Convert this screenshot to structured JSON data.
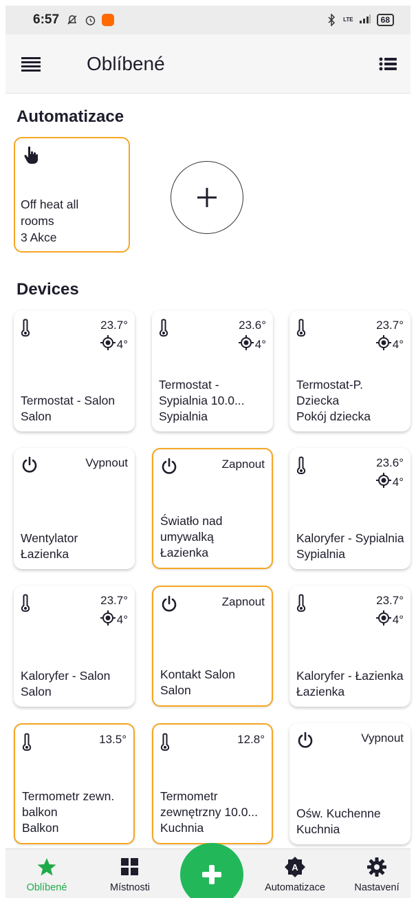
{
  "status_bar": {
    "time": "6:57",
    "battery": "68",
    "network": "LTE"
  },
  "header": {
    "title": "Oblíbené"
  },
  "automations": {
    "section_title": "Automatizace",
    "items": [
      {
        "name": "Off heat all rooms",
        "detail": "3 Akce"
      }
    ]
  },
  "devices": {
    "section_title": "Devices",
    "items": [
      {
        "type": "thermostat",
        "value": "23.7°",
        "target": "4°",
        "name": "Termostat - Salon",
        "room": "Salon",
        "active": false
      },
      {
        "type": "thermostat",
        "value": "23.6°",
        "target": "4°",
        "name": "Termostat - Sypialnia 10.0...",
        "room": "Sypialnia",
        "active": false
      },
      {
        "type": "thermostat",
        "value": "23.7°",
        "target": "4°",
        "name": "Termostat-P. Dziecka",
        "room": "Pokój dziecka",
        "active": false
      },
      {
        "type": "switch",
        "action": "Vypnout",
        "name": "Wentylator",
        "room": "Łazienka",
        "active": false
      },
      {
        "type": "switch",
        "action": "Zapnout",
        "name": "Światło nad umywalką",
        "room": "Łazienka",
        "active": true
      },
      {
        "type": "thermostat",
        "value": "23.6°",
        "target": "4°",
        "name": "Kaloryfer - Sypialnia",
        "room": "Sypialnia",
        "active": false
      },
      {
        "type": "thermostat",
        "value": "23.7°",
        "target": "4°",
        "name": "Kaloryfer - Salon",
        "room": "Salon",
        "active": false
      },
      {
        "type": "switch",
        "action": "Zapnout",
        "name": "Kontakt Salon",
        "room": "Salon",
        "active": true
      },
      {
        "type": "thermostat",
        "value": "23.7°",
        "target": "4°",
        "name": "Kaloryfer - Łazienka",
        "room": "Łazienka",
        "active": false
      },
      {
        "type": "thermometer",
        "value": "13.5°",
        "name": "Termometr zewn. balkon",
        "room": "Balkon",
        "active": true
      },
      {
        "type": "thermometer",
        "value": "12.8°",
        "name": "Termometr zewnętrzny 10.0...",
        "room": "Kuchnia",
        "active": true
      },
      {
        "type": "switch",
        "action": "Vypnout",
        "name": "Ośw. Kuchenne",
        "room": "Kuchnia",
        "active": false
      }
    ]
  },
  "bottom_nav": {
    "items": [
      {
        "label": "Oblíbené",
        "icon": "star-icon",
        "active": true
      },
      {
        "label": "Místnosti",
        "icon": "grid-icon",
        "active": false
      },
      {
        "label": "Automatizace",
        "icon": "automation-icon",
        "active": false
      },
      {
        "label": "Nastavení",
        "icon": "gear-icon",
        "active": false
      }
    ]
  },
  "colors": {
    "accent_orange": "#f5a623",
    "accent_green": "#22b85a",
    "text": "#1d1d2c"
  }
}
